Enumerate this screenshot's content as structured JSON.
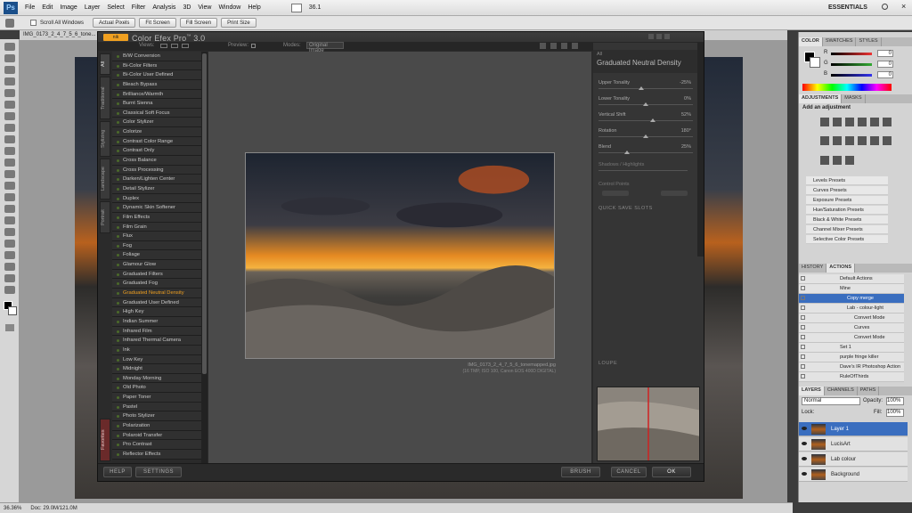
{
  "menubar": {
    "logo": "Ps",
    "items": [
      "File",
      "Edit",
      "Image",
      "Layer",
      "Select",
      "Filter",
      "Analysis",
      "3D",
      "View",
      "Window",
      "Help"
    ],
    "zoom": "36.1",
    "workspace": "ESSENTIALS"
  },
  "options": {
    "scroll_all": "Scroll All Windows",
    "buttons": [
      "Actual Pixels",
      "Fit Screen",
      "Fill Screen",
      "Print Size"
    ]
  },
  "document": {
    "tab_title": "IMG_0173_2_4_7_5_6_tone...",
    "zoom_status": "36.36%",
    "doc_size": "Doc: 29.0M/121.0M"
  },
  "cefx": {
    "title": "Color Efex Pro",
    "version": "3.0",
    "logo": "nik",
    "views_label": "Views:",
    "preview_label": "Preview:",
    "modes_label": "Modes:",
    "mode_value": "Original Image",
    "tabs": [
      "All",
      "Traditional",
      "Stylizing",
      "Landscape",
      "Portrait",
      "Favorites"
    ],
    "filters": [
      "B/W Conversion",
      "Bi-Color Filters",
      "Bi-Color User Defined",
      "Bleach Bypass",
      "Brilliance/Warmth",
      "Burnt Sienna",
      "Classical Soft Focus",
      "Color Stylizer",
      "Colorize",
      "Contrast Color Range",
      "Contrast Only",
      "Cross Balance",
      "Cross Processing",
      "Darken/Lighten Center",
      "Detail Stylizer",
      "Duplex",
      "Dynamic Skin Softener",
      "Film Effects",
      "Film Grain",
      "Flux",
      "Fog",
      "Foliage",
      "Glamour Glow",
      "Graduated Filters",
      "Graduated Fog",
      "Graduated Neutral Density",
      "Graduated User Defined",
      "High Key",
      "Indian Summer",
      "Infrared Film",
      "Infrared Thermal Camera",
      "Ink",
      "Low Key",
      "Midnight",
      "Monday Morning",
      "Old Photo",
      "Paper Toner",
      "Pastel",
      "Photo Stylizer",
      "Polarization",
      "Polaroid Transfer",
      "Pro Contrast",
      "Reflector Effects"
    ],
    "active_filter": "Graduated Neutral Density",
    "caption": "IMG_0173_2_4_7_5_6_tonemapped.jpg",
    "caption_meta": "(16 TMP, ISO 100, Canon EOS 400D DIGITAL)",
    "panel_category": "All",
    "panel_filter": "Graduated Neutral Density",
    "sliders": [
      {
        "label": "Upper Tonality",
        "value": "-25%",
        "pos": 0.45
      },
      {
        "label": "Lower Tonality",
        "value": "0%",
        "pos": 0.5
      },
      {
        "label": "Vertical Shift",
        "value": "52%",
        "pos": 0.58
      },
      {
        "label": "Rotation",
        "value": "180°",
        "pos": 0.5
      },
      {
        "label": "Blend",
        "value": "25%",
        "pos": 0.3
      }
    ],
    "shadows_label": "Shadows / Highlights",
    "control_points": "Control Points",
    "quick_save": "QUICK SAVE SLOTS",
    "loupe": "LOUPE",
    "buttons": {
      "help": "HELP",
      "settings": "SETTINGS",
      "brush": "BRUSH",
      "cancel": "CANCEL",
      "ok": "OK"
    }
  },
  "panels": {
    "color_tabs": [
      "COLOR",
      "SWATCHES",
      "STYLES"
    ],
    "rgb": [
      {
        "ch": "R",
        "v": "0"
      },
      {
        "ch": "G",
        "v": "0"
      },
      {
        "ch": "B",
        "v": "0"
      }
    ],
    "adj_tabs": [
      "ADJUSTMENTS",
      "MASKS"
    ],
    "add_adjustment": "Add an adjustment",
    "presets": [
      "Levels Presets",
      "Curves Presets",
      "Exposure Presets",
      "Hue/Saturation Presets",
      "Black & White Presets",
      "Channel Mixer Presets",
      "Selective Color Presets"
    ],
    "hist_tabs": [
      "HISTORY",
      "ACTIONS"
    ],
    "actions": [
      {
        "label": "Default Actions",
        "indent": 0,
        "sel": false
      },
      {
        "label": "Mine",
        "indent": 0,
        "sel": false
      },
      {
        "label": "Copy merge",
        "indent": 1,
        "sel": true
      },
      {
        "label": "Lab - colour-light",
        "indent": 1,
        "sel": false
      },
      {
        "label": "Convert Mode",
        "indent": 2,
        "sel": false
      },
      {
        "label": "Curves",
        "indent": 2,
        "sel": false
      },
      {
        "label": "Convert Mode",
        "indent": 2,
        "sel": false
      },
      {
        "label": "Set 1",
        "indent": 0,
        "sel": false
      },
      {
        "label": "purple fringe killer",
        "indent": 0,
        "sel": false
      },
      {
        "label": "Dave's IR Photoshop Action",
        "indent": 0,
        "sel": false
      },
      {
        "label": "RuleOfThirds",
        "indent": 0,
        "sel": false
      }
    ],
    "layer_tabs": [
      "LAYERS",
      "CHANNELS",
      "PATHS"
    ],
    "blend_mode": "Normal",
    "opacity_label": "Opacity:",
    "opacity": "100%",
    "lock_label": "Lock:",
    "fill_label": "Fill:",
    "fill": "100%",
    "layers": [
      {
        "name": "Layer 1",
        "sel": true
      },
      {
        "name": "LucisArt",
        "sel": false
      },
      {
        "name": "Lab colour",
        "sel": false
      },
      {
        "name": "Background",
        "sel": false
      }
    ]
  }
}
